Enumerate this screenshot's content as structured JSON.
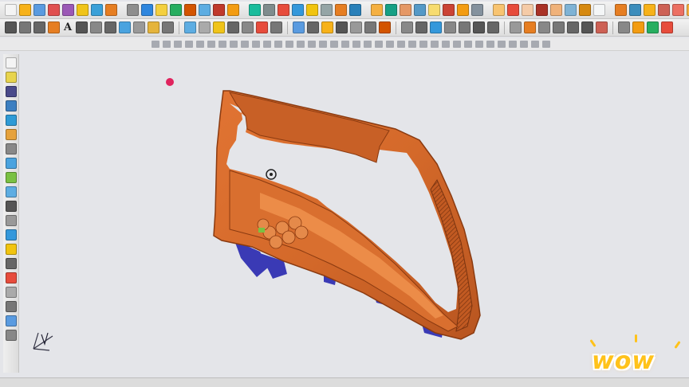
{
  "toolbar": {
    "text_tool_label": "A",
    "row1_icon_colors": [
      "#f4f4f4",
      "#f7b21a",
      "#5a9be0",
      "#e05050",
      "#9b59b6",
      "#f0c419",
      "#3aa0d8",
      "#e67e22",
      "#8e8e8e",
      "#2e86de",
      "#f4d03f",
      "#27ae60",
      "#d35400",
      "#5dade2",
      "#c0392b",
      "#f39c12",
      "#1abc9c",
      "#7f8c8d",
      "#e74c3c",
      "#3498db",
      "#f1c40f",
      "#95a5a6",
      "#e67e22",
      "#2980b9",
      "#f5b041",
      "#16a085",
      "#e59866",
      "#5499c7",
      "#f7dc6f",
      "#cb4335",
      "#f39c12",
      "#85929e",
      "#f8c471",
      "#e74c3c",
      "#f5cba7",
      "#a93226",
      "#f0b27a",
      "#7fb3d5",
      "#d68910",
      "#f4f6f7",
      "#e67e22",
      "#3c8dbc",
      "#f7b21a",
      "#cd6155",
      "#ec7063",
      "#f5b041",
      "#d35400",
      "#f0f3f4",
      "#c0392b"
    ],
    "row2_icon_colors": [
      "#555",
      "#777",
      "#666",
      "#e67e22",
      "#555",
      "#888",
      "#666",
      "#4aa3df",
      "#999",
      "#e5b43c",
      "#777",
      "#5dade2",
      "#aaa",
      "#f0c419",
      "#666",
      "#888",
      "#e74c3c",
      "#777",
      "#5a9be0",
      "#666",
      "#f7b21a",
      "#555",
      "#999",
      "#777",
      "#d35400",
      "#888",
      "#666",
      "#3498db",
      "#888",
      "#777",
      "#555",
      "#666",
      "#999",
      "#e67e22",
      "#888",
      "#777",
      "#666",
      "#555",
      "#cd6155",
      "#888",
      "#f39c12",
      "#27ae60",
      "#e74c3c"
    ]
  },
  "left_toolbar": {
    "icon_colors": [
      "#f4f4f4",
      "#e8d44d",
      "#4a4a8a",
      "#3c7fc1",
      "#2e9bd6",
      "#e6a23c",
      "#888",
      "#4aa3df",
      "#7ac143",
      "#5dade2",
      "#555",
      "#999",
      "#3498db",
      "#f1c40f",
      "#666",
      "#e74c3c",
      "#aaa",
      "#777",
      "#5a9be0",
      "#888"
    ]
  },
  "model": {
    "body_color": "#d4692a",
    "highlight_color": "#f29552",
    "shadow_color": "#9c4617",
    "rib_color": "#3a3ab5",
    "marker_color": "#e0245e"
  },
  "overlay": {
    "badge_text": "wow"
  }
}
